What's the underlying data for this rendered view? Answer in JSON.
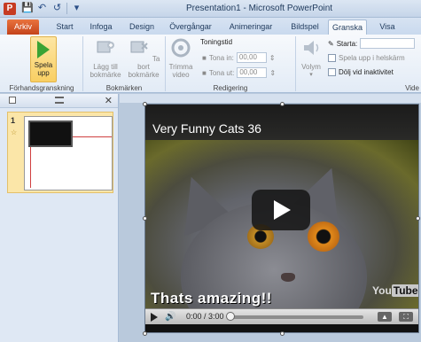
{
  "window": {
    "title": "Presentation1  -  Microsoft PowerPoint",
    "app_icon_letter": "P",
    "qat": {
      "save_icon": "save-icon",
      "undo_icon": "undo-icon",
      "redo_icon": "redo-icon"
    }
  },
  "tabs": {
    "file": "Arkiv",
    "items": [
      "Start",
      "Infoga",
      "Design",
      "Övergångar",
      "Animeringar",
      "Bildspel",
      "Granska",
      "Visa"
    ]
  },
  "ribbon": {
    "preview_group": {
      "play_label": "Spela upp",
      "label": "Förhandsgranskning"
    },
    "bookmarks_group": {
      "add_label": "Lägg till bokmärke",
      "remove_label": "Ta bort bokmärke",
      "label": "Bokmärken"
    },
    "editing_group": {
      "trim_label": "Trimma video",
      "fade_heading": "Toningstid",
      "fade_in_label": "Tona in:",
      "fade_in_value": "00,00",
      "fade_out_label": "Tona ut:",
      "fade_out_value": "00,00",
      "label": "Redigering"
    },
    "video_options_group": {
      "volume_label": "Volym",
      "start_label": "Starta:",
      "fullscreen_label": "Spela upp i helskärm",
      "hide_label": "Dölj vid inaktivitet",
      "label": "Vide"
    }
  },
  "slides_panel": {
    "slide_number": "1"
  },
  "video": {
    "title": "Very Funny Cats 36",
    "caption": "Thats amazing!!",
    "youtube_logo_prefix": "You",
    "youtube_logo_suffix": "Tube",
    "time": "0:00 / 3:00",
    "progress": 0
  }
}
